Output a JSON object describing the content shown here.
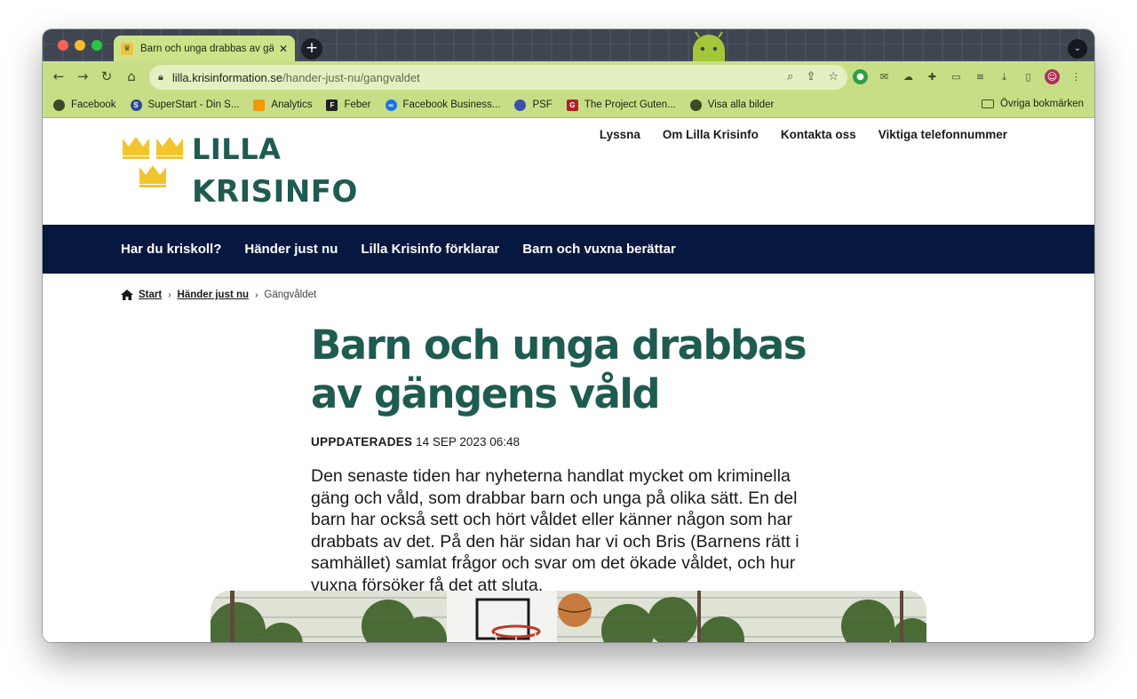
{
  "browser": {
    "tab": {
      "title": "Barn och unga drabbas av gängens våld",
      "close_glyph": "✕"
    },
    "new_tab_glyph": "+",
    "url": {
      "host": "lilla.krisinformation.se",
      "path": "/hander-just-nu/gangvaldet"
    },
    "bookmarks": [
      {
        "label": "Facebook",
        "icon": "globe-icon",
        "color": "#3c4a26"
      },
      {
        "label": "SuperStart - Din S...",
        "icon": "s-icon",
        "color": "#2b4a9a"
      },
      {
        "label": "Analytics",
        "icon": "analytics-icon",
        "color": "#f29900"
      },
      {
        "label": "Feber",
        "icon": "feber-icon",
        "color": "#222222"
      },
      {
        "label": "Facebook Business...",
        "icon": "meta-icon",
        "color": "#1a73e8"
      },
      {
        "label": "PSF",
        "icon": "psf-icon",
        "color": "#3a4fb0"
      },
      {
        "label": "The Project Guten...",
        "icon": "gutenberg-icon",
        "color": "#b0202a"
      },
      {
        "label": "Visa alla bilder",
        "icon": "globe-icon",
        "color": "#3c4a26"
      }
    ],
    "other_bookmarks": "Övriga bokmärken"
  },
  "site": {
    "logo": {
      "line1": "LILLA",
      "line2": "KRISINFO",
      "crown_color": "#f2c52e",
      "text_color": "#1e5b50"
    },
    "top_nav": [
      "Lyssna",
      "Om Lilla Krisinfo",
      "Kontakta oss",
      "Viktiga telefonnummer"
    ],
    "main_nav": [
      "Har du kriskoll?",
      "Händer just nu",
      "Lilla Krisinfo förklarar",
      "Barn och vuxna berättar"
    ],
    "main_nav_bg": "#061840",
    "breadcrumb": {
      "home": "Start",
      "section": "Händer just nu",
      "current": "Gängvåldet"
    }
  },
  "article": {
    "title": "Barn och unga drabbas av gängens våld",
    "updated_label": "UPPDATERADES",
    "updated_value": "14 SEP 2023 06:48",
    "ingress": "Den senaste tiden har nyheterna handlat mycket om kriminella gäng och våld, som drabbar barn och unga på olika sätt. En del barn har också sett och hört våldet eller känner någon som har drabbats av det. På den här sidan har vi och Bris (Barnens rätt i samhället) samlat frågor och svar om det ökade våldet, och hur vuxna försöker få det att sluta."
  }
}
